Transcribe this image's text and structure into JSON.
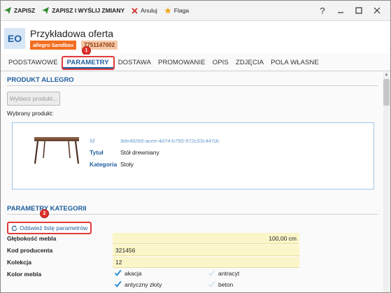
{
  "toolbar": {
    "save": "ZAPISZ",
    "save_send": "ZAPISZ I WYŚLIJ ZMIANY",
    "cancel": "Anuluj",
    "flag": "Flaga",
    "help": "?",
    "colors": {
      "save_icon": "#2e8b2e",
      "cancel_icon": "#d42b2b",
      "flag_icon": "#f0a818"
    }
  },
  "header": {
    "avatar": "EO",
    "title": "Przykładowa oferta",
    "env_badge": "allegro Sandbox",
    "offer_id": "7751147002"
  },
  "tabs": [
    {
      "label": "PODSTAWOWE",
      "active": false
    },
    {
      "label": "PARAMETRY",
      "active": true
    },
    {
      "label": "DOSTAWA",
      "active": false
    },
    {
      "label": "PROMOWANIE",
      "active": false
    },
    {
      "label": "OPIS",
      "active": false
    },
    {
      "label": "ZDJĘCIA",
      "active": false
    },
    {
      "label": "POLA WŁASNE",
      "active": false
    }
  ],
  "product_section": {
    "heading": "PRODUKT ALLEGRO",
    "select_button": "Wybierz produkt...",
    "selected_label": "Wybrany produkt:",
    "card": {
      "id_label": "Id",
      "id_value": "9de48266-acee-4d74-b790-972c53c447dc",
      "title_label": "Tytuł",
      "title_value": "Stół drewniany",
      "category_label": "Kategoria",
      "category_value": "Stoły"
    }
  },
  "category_section": {
    "heading": "PARAMETRY KATEGORII",
    "refresh_button": "Odśwież listę parametrów",
    "params": [
      {
        "label": "Głębokość mebla",
        "value": "100,00 cm",
        "align": "right"
      },
      {
        "label": "Kod producenta",
        "value": "321456",
        "align": "left"
      },
      {
        "label": "Kolekcja",
        "value": "12",
        "align": "left"
      },
      {
        "label": "Kolor mebla",
        "value": "",
        "align": "left"
      }
    ],
    "color_options": [
      {
        "label": "akacja",
        "checked": true
      },
      {
        "label": "antracyt",
        "checked": false
      },
      {
        "label": "antyczny złoty",
        "checked": true
      },
      {
        "label": "beton",
        "checked": false
      }
    ]
  },
  "markers": [
    "1",
    "2"
  ],
  "colors": {
    "accent": "#1e5d9e",
    "highlight": "#e23a3a",
    "input_bg": "#fbf6c9",
    "env_badge": "#f36d1f"
  }
}
